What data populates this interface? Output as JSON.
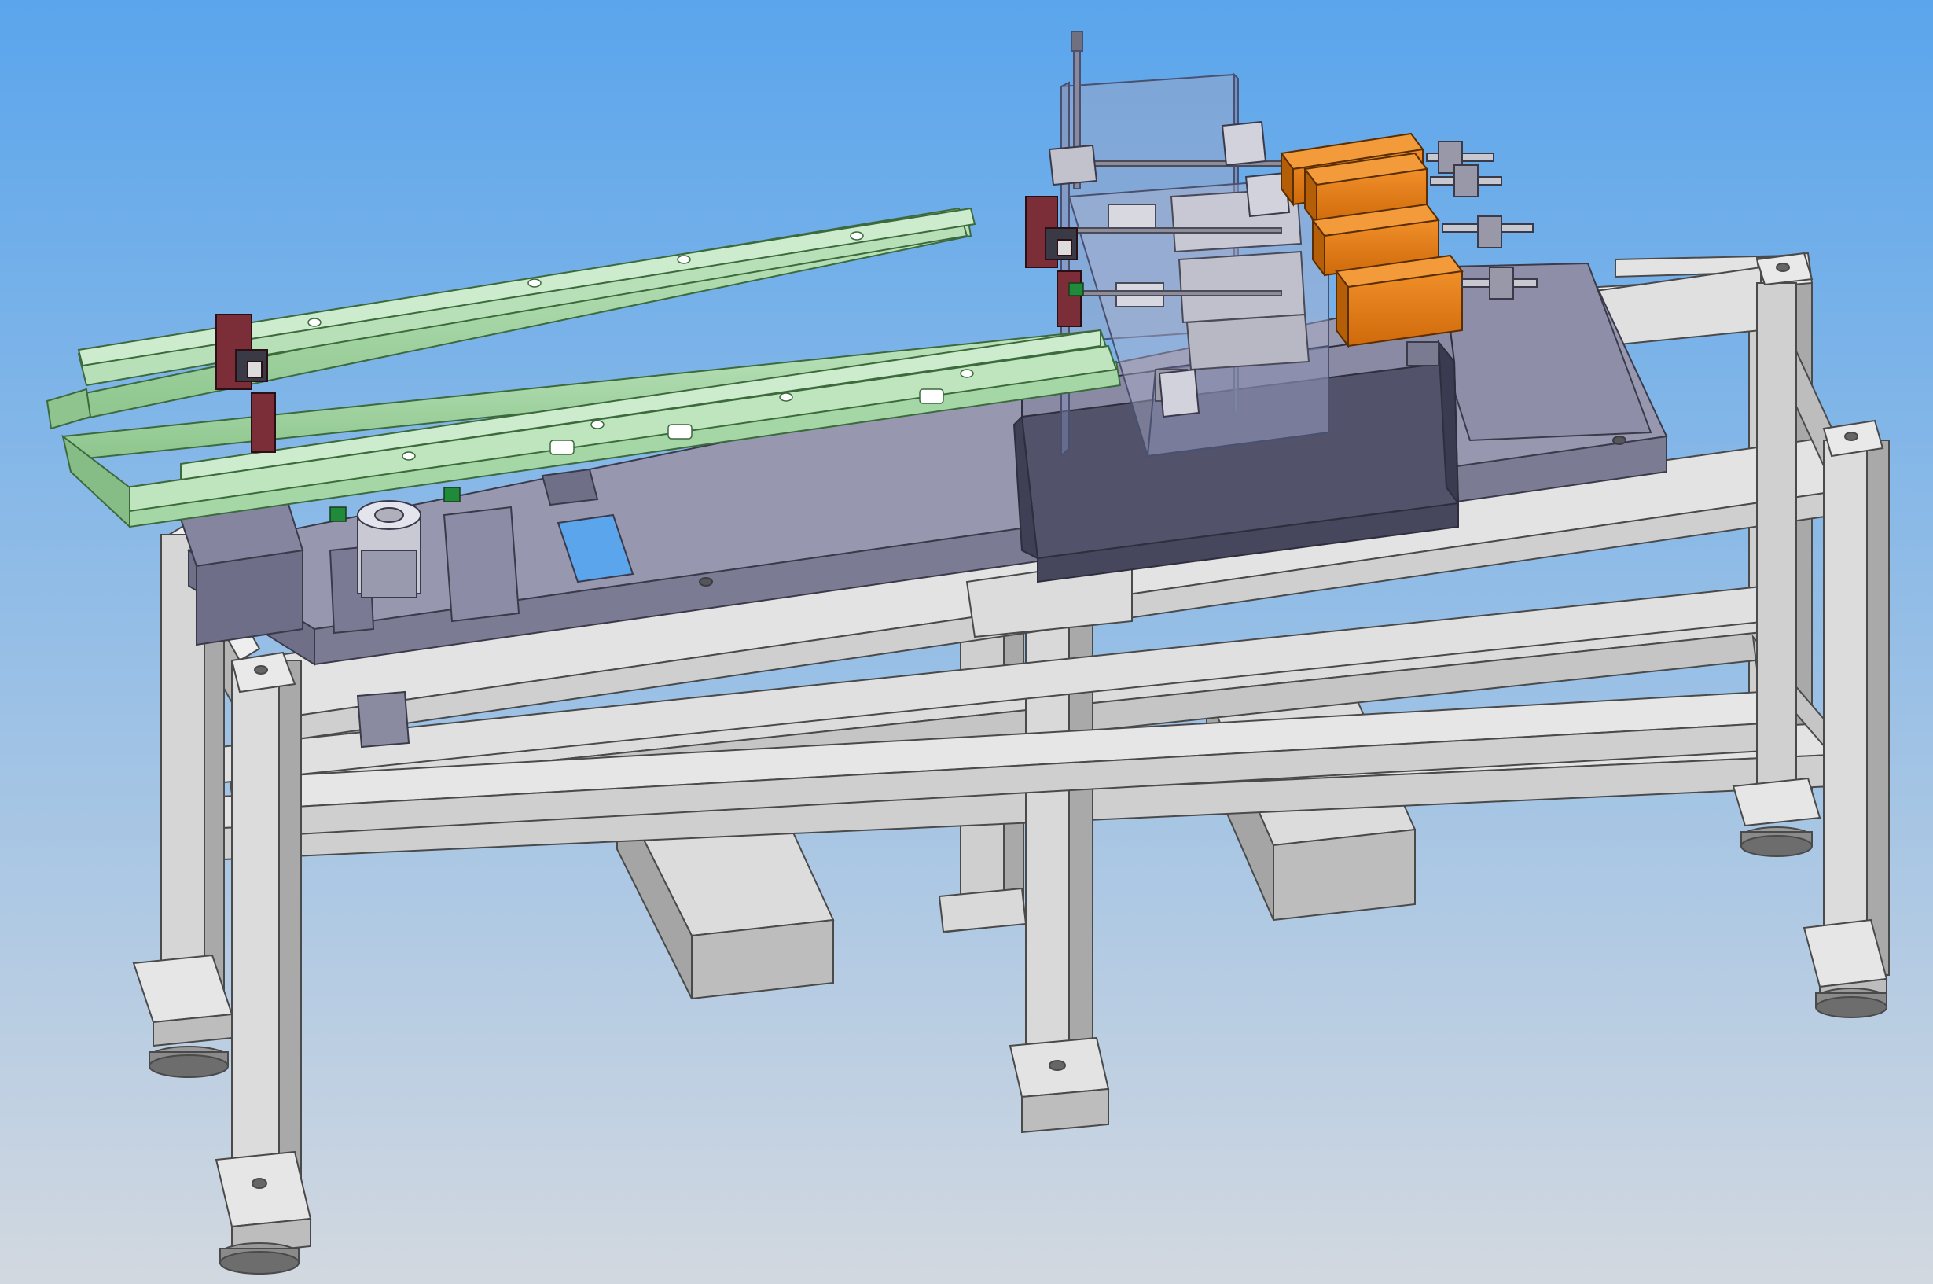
{
  "viewport": {
    "background_top": "#5aa5ec",
    "background_bottom": "#d2d8e0"
  },
  "palette": {
    "frame_front": "#d9d9d9",
    "frame_side": "#a9a9a9",
    "frame_top": "#eeeeee",
    "frame_edge": "#4a4a4a",
    "plate_top": "#9898b2",
    "plate_side": "#7c7c95",
    "dark_block": "#545465",
    "green_rail": "#a7d7a7",
    "green_rail_dark": "#6fa86f",
    "orange_block": "#e07c14",
    "orange_side": "#b35d08",
    "glass": "rgba(170,180,210,0.45)",
    "red_clamp": "#7a2a35"
  },
  "components": [
    "base-frame",
    "top-plate",
    "green-rail-upper",
    "green-rail-lower",
    "clamp-units",
    "pneumatic-cylinder",
    "transparent-guard",
    "orange-actuator-blocks",
    "leveling-feet"
  ]
}
